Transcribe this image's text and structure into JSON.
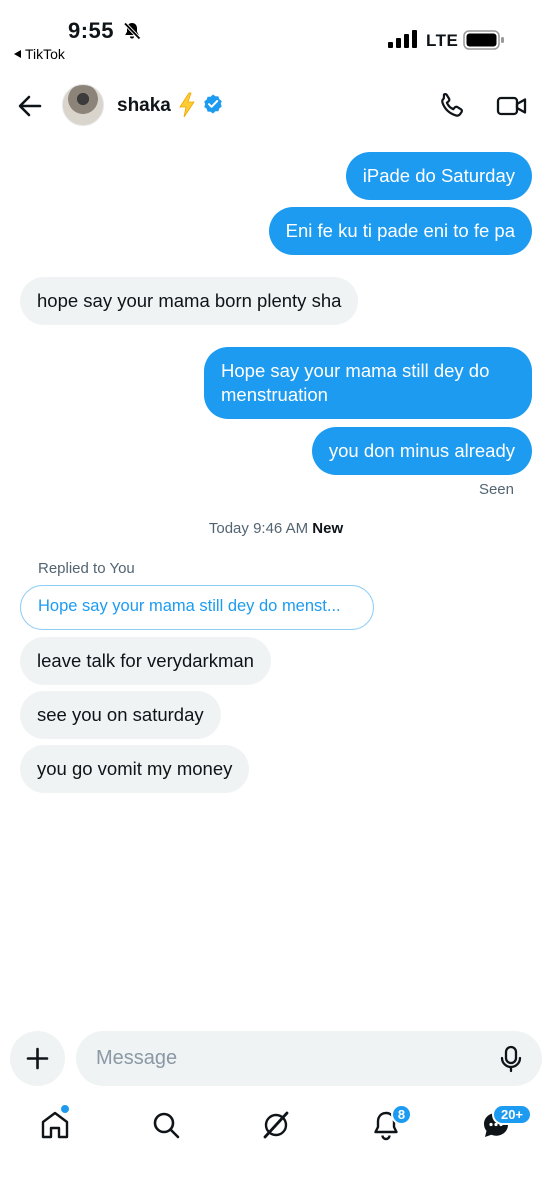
{
  "status_bar": {
    "time": "9:55",
    "back_app": "TikTok",
    "network": "LTE"
  },
  "header": {
    "username": "shaka",
    "icons": [
      "back-arrow-icon",
      "lightning-bolt-icon",
      "verified-badge-icon",
      "phone-icon",
      "video-camera-icon"
    ]
  },
  "messages": [
    {
      "side": "out",
      "text": "iPade do Saturday"
    },
    {
      "side": "out",
      "text": "Eni fe ku ti pade eni to fe pa"
    },
    {
      "side": "in",
      "text": "hope say your mama born plenty sha"
    },
    {
      "side": "out",
      "text": "Hope say your mama still dey do",
      "text2": "menstruation"
    },
    {
      "side": "out",
      "text": "you don minus already"
    },
    {
      "side": "in",
      "text": "leave talk for verydarkman"
    },
    {
      "side": "in",
      "text": "see you on saturday"
    },
    {
      "side": "in",
      "text": "you go vomit my money"
    }
  ],
  "seen_label": "Seen",
  "divider": {
    "time": "Today 9:46 AM",
    "new_label": "New"
  },
  "reply": {
    "label": "Replied to You",
    "quote": "Hope say your mama still dey do menst..."
  },
  "compose": {
    "placeholder": "Message"
  },
  "tabbar": {
    "notifications_badge": "8",
    "messages_badge": "20+"
  },
  "colors": {
    "accent": "#1d9bf0",
    "incoming_bubble": "#eff3f4",
    "text": "#0f1419",
    "muted": "#536471"
  }
}
